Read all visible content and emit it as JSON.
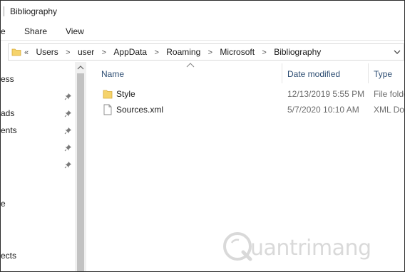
{
  "window": {
    "title": "Bibliography"
  },
  "ribbon": {
    "tabs": [
      "e",
      "Share",
      "View"
    ]
  },
  "address": {
    "overflow_label": "«",
    "crumbs": [
      "Users",
      "user",
      "AppData",
      "Roaming",
      "Microsoft",
      "Bibliography"
    ]
  },
  "nav": {
    "items": [
      {
        "label": "ess",
        "pinned": false
      },
      {
        "label": "",
        "pinned": true
      },
      {
        "label": "ads",
        "pinned": true
      },
      {
        "label": "ents",
        "pinned": true
      },
      {
        "label": "",
        "pinned": true
      },
      {
        "label": "",
        "pinned": true
      },
      {
        "label": "e",
        "pinned": false
      },
      {
        "label": "ects",
        "pinned": false
      }
    ]
  },
  "columns": {
    "name": "Name",
    "date": "Date modified",
    "type": "Type"
  },
  "files": [
    {
      "name": "Style",
      "date": "12/13/2019 5:55 PM",
      "type": "File folde",
      "icon": "folder-icon"
    },
    {
      "name": "Sources.xml",
      "date": "5/7/2020 10:10 AM",
      "type": "XML Doc",
      "icon": "document-icon"
    }
  ],
  "watermark": {
    "text": "uantrimang"
  },
  "colors": {
    "header_text": "#2e4e73",
    "folder_yellow": "#f5d36b",
    "secondary_text": "#6d6d6d"
  }
}
